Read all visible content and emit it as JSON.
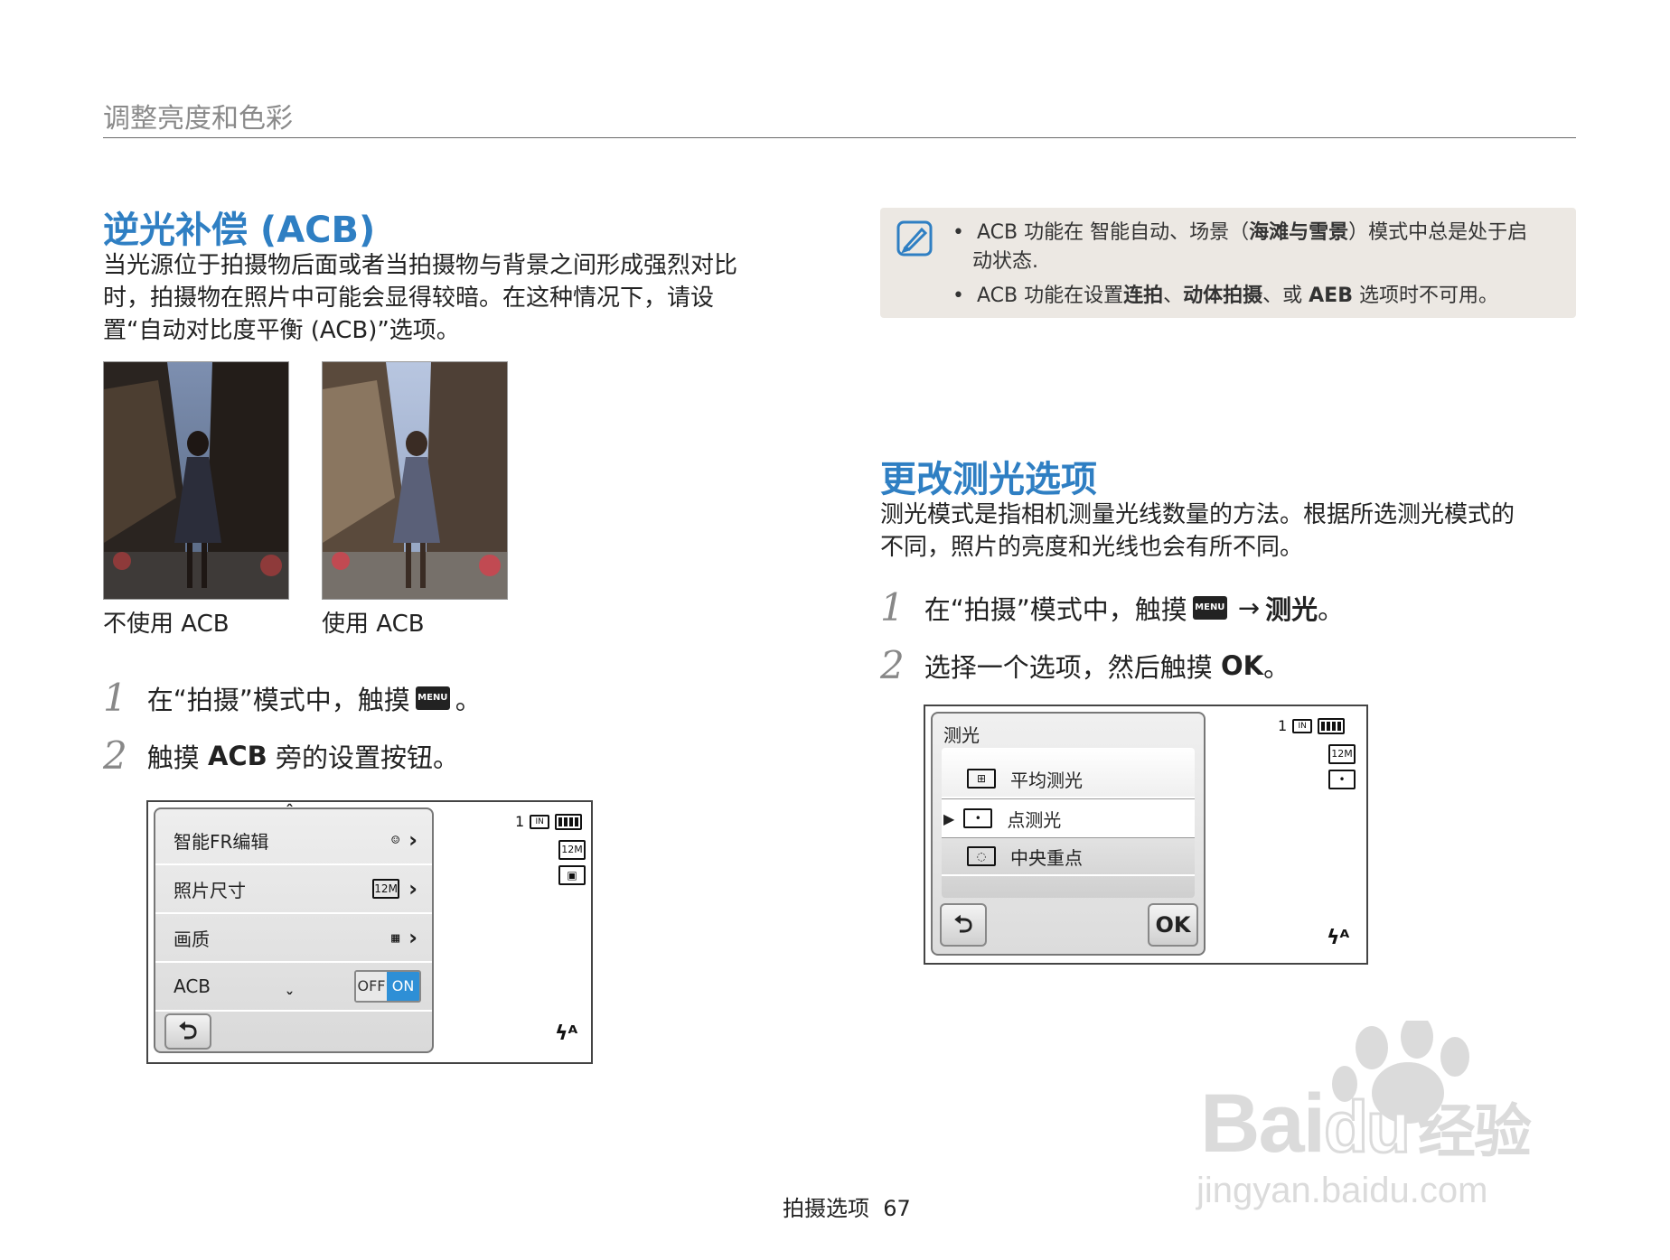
{
  "header": {
    "section_title": "调整亮度和色彩"
  },
  "acb": {
    "title": "逆光补偿 (ACB)",
    "intro_lines": [
      "当光源位于拍摄物后面或者当拍摄物与背景之间形成强烈对比",
      "时，拍摄物在照片中可能会显得较暗。在这种情况下，请设",
      "置“自动对比度平衡 (ACB)”选项。"
    ],
    "photo_captions": [
      "不使用 ACB",
      "使用 ACB"
    ],
    "steps": [
      {
        "num": "1",
        "text_before": "在“拍摄”模式中，触摸",
        "icon_label": "MENU",
        "text_after": "。"
      },
      {
        "num": "2",
        "text_before": "触摸 ",
        "bold": "ACB",
        "text_after": " 旁的设置按钮。"
      }
    ],
    "screen": {
      "rows": [
        {
          "label": "智能FR编辑",
          "icon": "face-edit-icon"
        },
        {
          "label": "照片尺寸",
          "icon": "12M"
        },
        {
          "label": "画质",
          "icon": "quality-icon"
        },
        {
          "label": "ACB",
          "toggle_off": "OFF",
          "toggle_on": "ON"
        }
      ],
      "status_count": "1",
      "status_size": "12M"
    }
  },
  "note": {
    "line1_a": "ACB 功能在 智能自动、场景（",
    "line1_bold": "海滩与雪景",
    "line1_b": "）模式中总是处于启",
    "line1_c": "动状态.",
    "line2_a": "ACB 功能在设置",
    "line2_bold1": "连拍",
    "line2_sep1": "、",
    "line2_bold2": "动体拍摄",
    "line2_sep2": "、或 ",
    "line2_bold3": "AEB",
    "line2_b": " 选项时不可用。"
  },
  "metering": {
    "title": "更改测光选项",
    "intro_lines": [
      "测光模式是指相机测量光线数量的方法。根据所选测光模式的",
      "不同，照片的亮度和光线也会有所不同。"
    ],
    "steps": [
      {
        "num": "1",
        "text_before": "在“拍摄”模式中，触摸",
        "icon_label": "MENU",
        "arrow": "→",
        "bold": "测光",
        "text_after": "。"
      },
      {
        "num": "2",
        "text_before": "选择一个选项，然后触摸 ",
        "bold": "OK",
        "text_after": "。"
      }
    ],
    "screen": {
      "panel_title": "测光",
      "options": [
        "平均测光",
        "点测光",
        "中央重点"
      ],
      "ok_label": "OK",
      "status_count": "1",
      "status_size": "12M"
    }
  },
  "footer": {
    "page_label": "拍摄选项",
    "page_number": "67"
  },
  "watermark": {
    "brand": "Bai",
    "brand2": "du",
    "cn": "经验",
    "url": "jingyan.baidu.com"
  }
}
